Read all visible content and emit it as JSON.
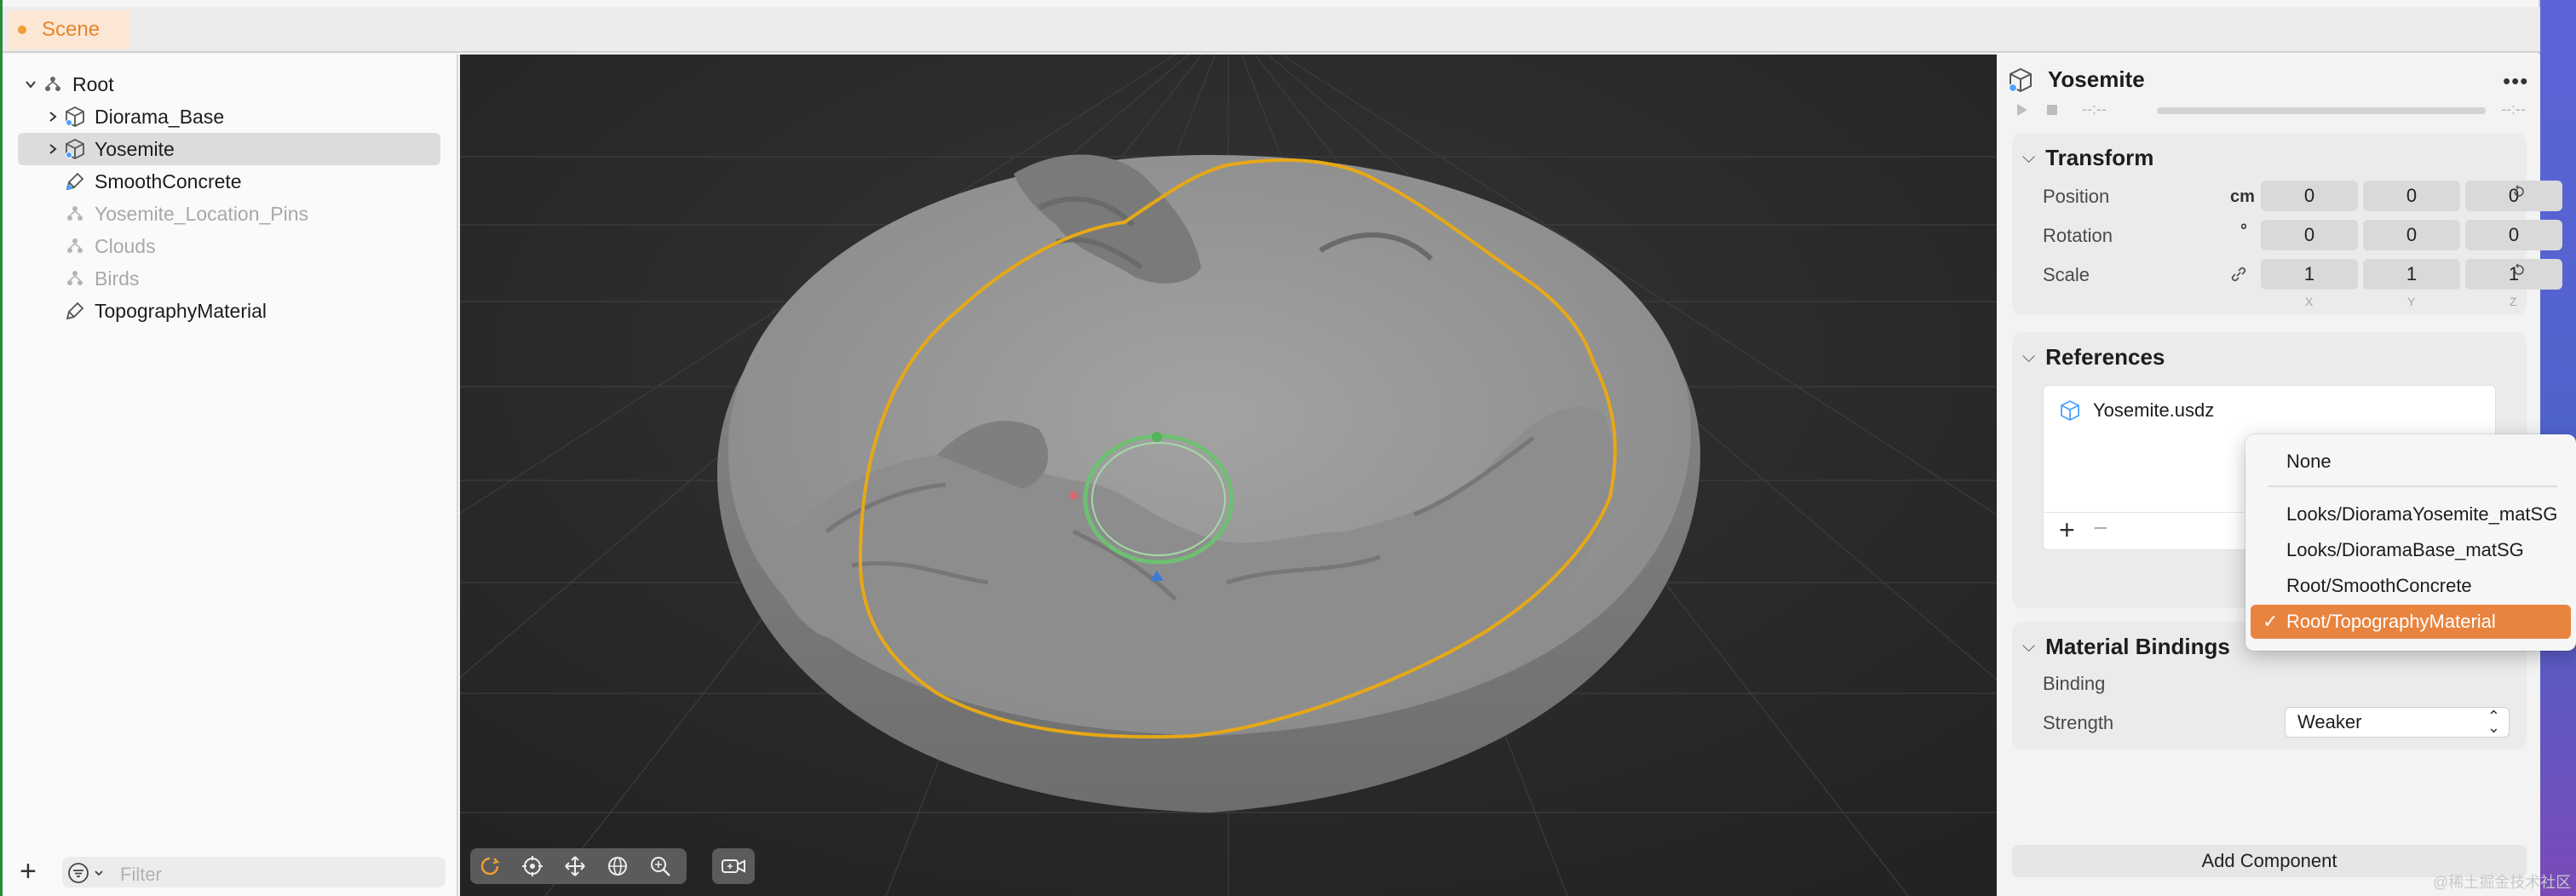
{
  "tab": {
    "label": "Scene"
  },
  "navigator": {
    "items": [
      {
        "label": "Root",
        "kind": "group-icon",
        "dim": false
      },
      {
        "label": "Diorama_Base",
        "kind": "model-icon",
        "dim": false
      },
      {
        "label": "Yosemite",
        "kind": "model-icon",
        "dim": false
      },
      {
        "label": "SmoothConcrete",
        "kind": "material-icon",
        "dim": false
      },
      {
        "label": "Yosemite_Location_Pins",
        "kind": "group-icon",
        "dim": true
      },
      {
        "label": "Clouds",
        "kind": "group-icon",
        "dim": true
      },
      {
        "label": "Birds",
        "kind": "group-icon",
        "dim": true
      },
      {
        "label": "TopographyMaterial",
        "kind": "material-icon",
        "dim": false
      }
    ],
    "selected": "Yosemite",
    "filter_placeholder": "Filter"
  },
  "inspector": {
    "title": "Yosemite",
    "time_start": "--:--",
    "time_end": "--:--",
    "transform": {
      "title": "Transform",
      "position_label": "Position",
      "position_unit": "cm",
      "position": [
        "0",
        "0",
        "0"
      ],
      "rotation_label": "Rotation",
      "rotation_unit": "°",
      "rotation": [
        "0",
        "0",
        "0"
      ],
      "scale_label": "Scale",
      "scale": [
        "1",
        "1",
        "1"
      ],
      "axes": [
        "X",
        "Y",
        "Z"
      ]
    },
    "references": {
      "title": "References",
      "file": "Yosemite.usdz"
    },
    "material_bindings": {
      "title": "Material Bindings",
      "binding_label": "Binding",
      "strength_label": "Strength",
      "strength_value": "Weaker"
    },
    "add_component": "Add Component"
  },
  "binding_menu": {
    "items": [
      "None",
      "Looks/DioramaYosemite_matSG",
      "Looks/DioramaBase_matSG",
      "Root/SmoothConcrete",
      "Root/TopographyMaterial"
    ],
    "selected": "Root/TopographyMaterial"
  },
  "watermark": "@稀土掘金技术社区",
  "colors": {
    "accent": "#e8843f",
    "selection_outline": "#e6a817",
    "viewport_bg": "#2b2b2b"
  }
}
